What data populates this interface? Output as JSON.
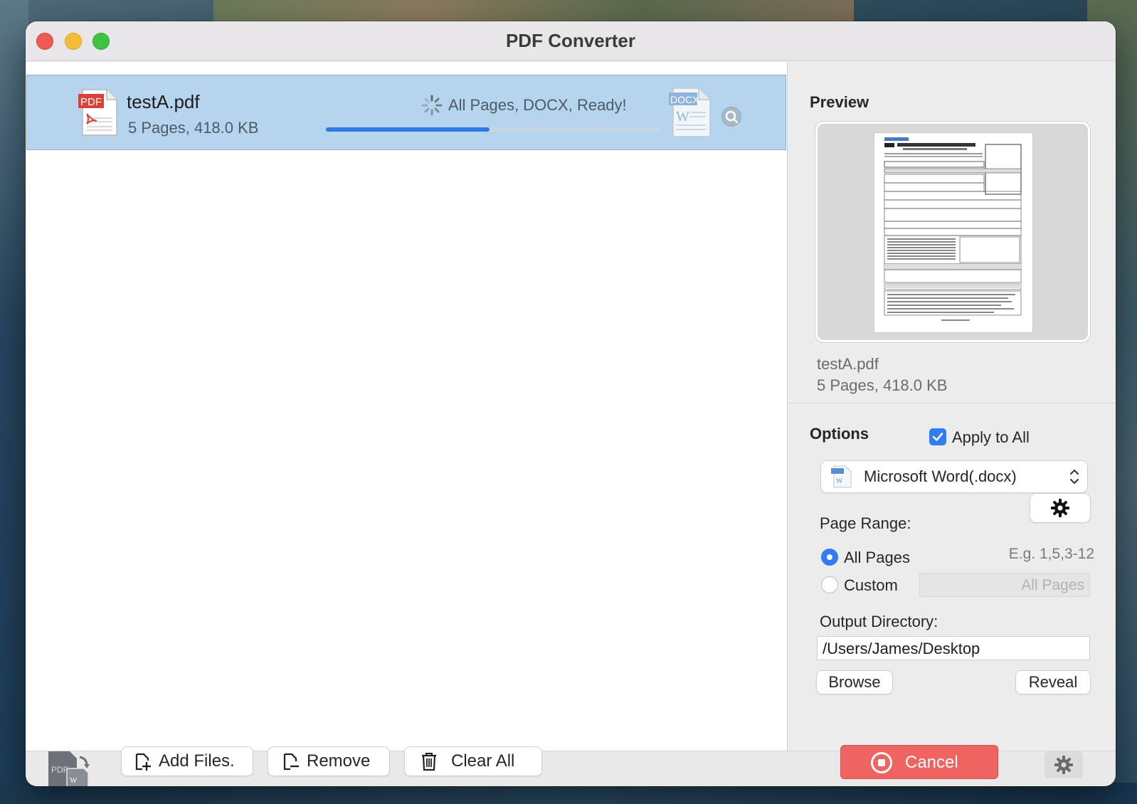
{
  "window": {
    "title": "PDF Converter"
  },
  "files": [
    {
      "name": "testA.pdf",
      "meta": "5 Pages, 418.0 KB",
      "status": "All Pages, DOCX, Ready!",
      "progress": 0.49,
      "source_icon_text": "PDF",
      "target_icon_text": "DOCX"
    }
  ],
  "preview": {
    "label": "Preview",
    "file_name": "testA.pdf",
    "file_meta": "5 Pages, 418.0 KB"
  },
  "options": {
    "label": "Options",
    "apply_to_all_label": "Apply to All",
    "apply_to_all_checked": true,
    "format_selected": "Microsoft Word(.docx)",
    "page_range_label": "Page Range:",
    "all_pages_label": "All Pages",
    "custom_label": "Custom",
    "page_range_mode": "All Pages",
    "example_hint": "E.g. 1,5,3-12",
    "custom_placeholder": "All Pages",
    "output_directory_label": "Output Directory:",
    "output_directory": "/Users/James/Desktop",
    "browse_label": "Browse",
    "reveal_label": "Reveal"
  },
  "toolbar": {
    "add_files_label": "Add Files.",
    "remove_label": "Remove",
    "clear_all_label": "Clear All",
    "cancel_label": "Cancel"
  },
  "colors": {
    "selection": "#b5d5ee",
    "accent": "#2f7cf6",
    "progress": "#2d7ae4",
    "cancel": "#ef6360",
    "pdf_red": "#d9413a"
  },
  "icons": {
    "spinner": "loading-spinner-icon",
    "zoom": "magnifier-icon",
    "gear": "gear-icon"
  }
}
